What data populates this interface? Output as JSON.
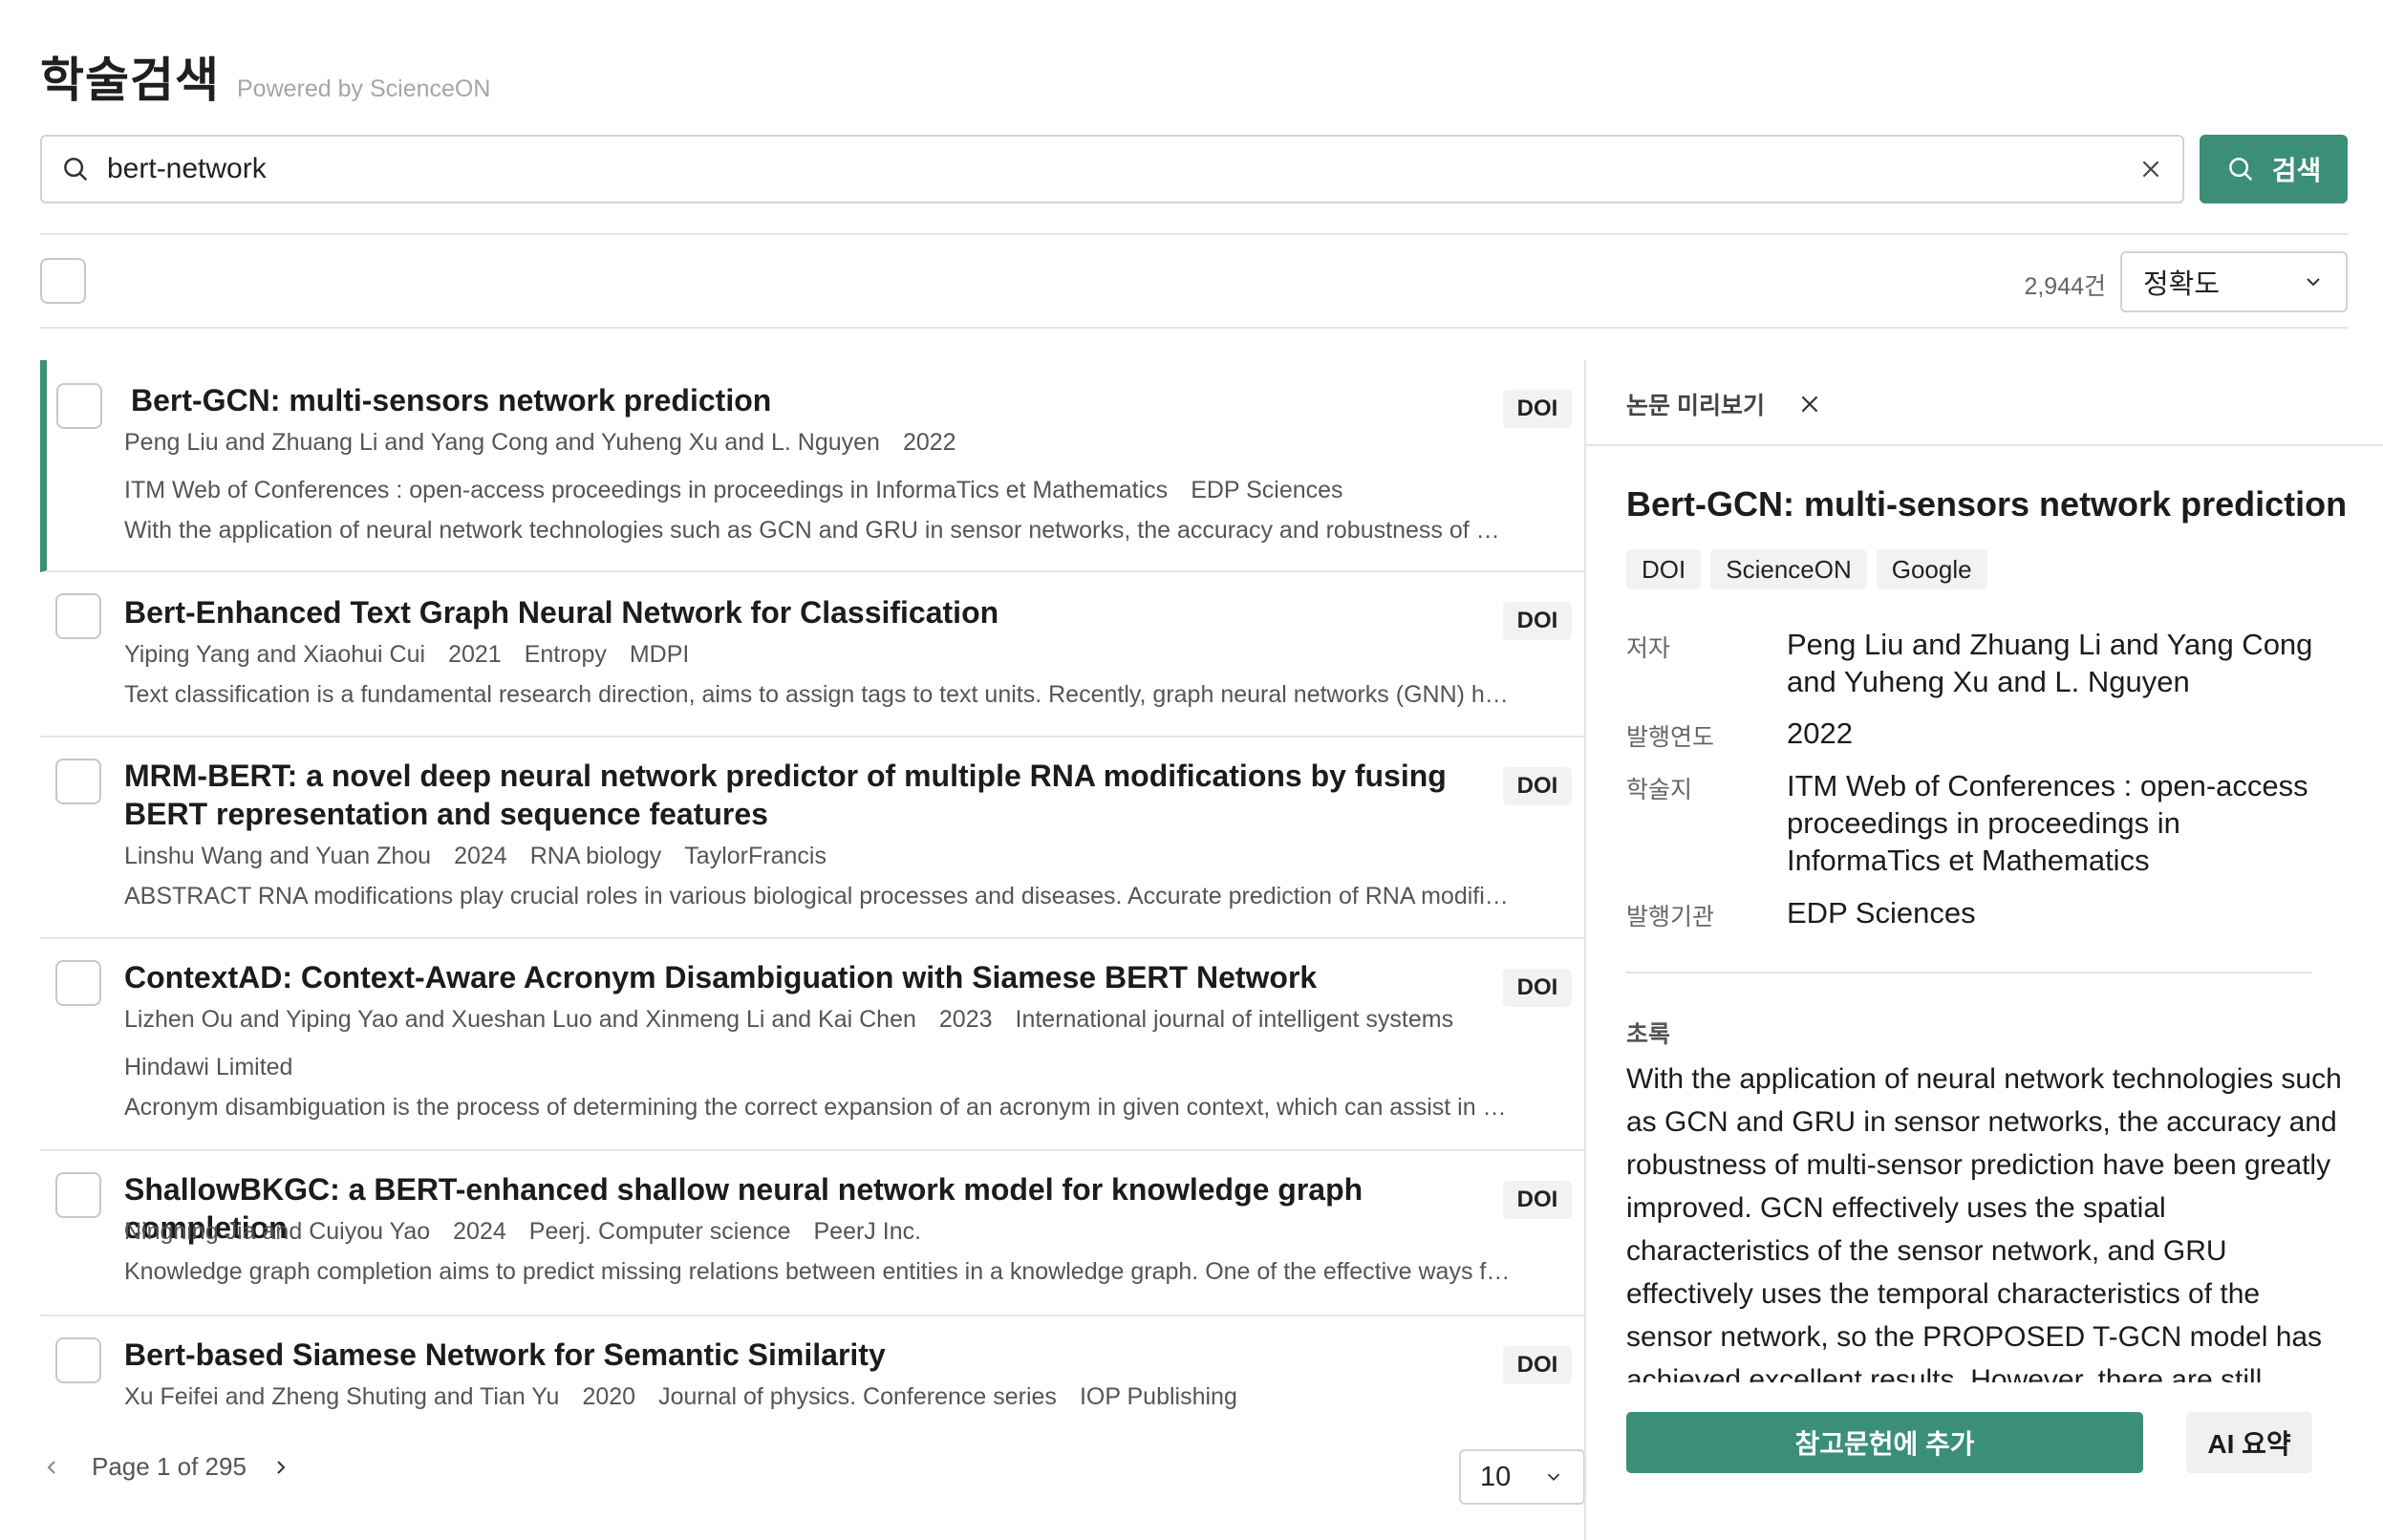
{
  "header": {
    "title": "학술검색",
    "powered_by": "Powered by ScienceON"
  },
  "search": {
    "query": "bert-network",
    "button_label": "검색"
  },
  "toolbar": {
    "result_count": "2,944건",
    "sort": "정확도"
  },
  "results": [
    {
      "title": "Bert-GCN: multi-sensors network prediction",
      "meta_line1": [
        "Peng Liu and Zhuang Li and Yang Cong and Yuheng Xu and L. Nguyen",
        "2022"
      ],
      "meta_line2": [
        "ITM Web of Conferences : open-access proceedings in proceedings in InformaTics et Mathematics",
        "EDP Sciences"
      ],
      "abstract": "With the application of neural network technologies such as GCN and GRU in sensor networks, the accuracy and robustness of multi-sensor prediction have been greatly improved.",
      "badge": "DOI",
      "selected": true
    },
    {
      "title": "Bert-Enhanced Text Graph Neural Network for Classification",
      "meta_line1": [
        "Yiping Yang and Xiaohui Cui",
        "2021",
        "Entropy",
        "MDPI"
      ],
      "abstract": "Text classification is a fundamental research direction, aims to assign tags to text units. Recently, graph neural networks (GNN) have exhibited some excellent properties.",
      "badge": "DOI"
    },
    {
      "title": "MRM-BERT: a novel deep neural network predictor of multiple RNA modifications by fusing BERT representation and sequence features",
      "meta_line1": [
        "Linshu Wang and Yuan Zhou",
        "2024",
        "RNA biology",
        "TaylorFrancis"
      ],
      "abstract": "ABSTRACT RNA modifications play crucial roles in various biological processes and diseases. Accurate prediction of RNA modification sites is essential.",
      "badge": "DOI"
    },
    {
      "title": "ContextAD: Context-Aware Acronym Disambiguation with Siamese BERT Network",
      "meta_line1": [
        "Lizhen Ou and Yiping Yao and Xueshan Luo and Xinmeng Li and Kai Chen",
        "2023",
        "International journal of intelligent systems"
      ],
      "meta_line2": [
        "Hindawi Limited"
      ],
      "abstract": "Acronym disambiguation is the process of determining the correct expansion of an acronym in given context, which can assist in understanding text.",
      "badge": "DOI"
    },
    {
      "title": "ShallowBKGC: a BERT-enhanced shallow neural network model for knowledge graph completion",
      "meta_line1": [
        "Ningning Jia and Cuiyou Yao",
        "2024",
        "Peerj. Computer science",
        "PeerJ Inc."
      ],
      "abstract": "Knowledge graph completion aims to predict missing relations between entities in a knowledge graph. One of the effective ways for knowledge graph completion is",
      "badge": "DOI"
    },
    {
      "title": "Bert-based Siamese Network for Semantic Similarity",
      "meta_line1": [
        "Xu Feifei and Zheng Shuting and Tian Yu",
        "2020",
        "Journal of physics. Conference series",
        "IOP Publishing"
      ],
      "badge": "DOI"
    }
  ],
  "pagination": {
    "label": "Page 1 of 295",
    "page_size": "10"
  },
  "preview": {
    "heading": "논문 미리보기",
    "title": "Bert-GCN: multi-sensors network prediction",
    "links": [
      "DOI",
      "ScienceON",
      "Google"
    ],
    "fields": [
      {
        "label": "저자",
        "value": "Peng Liu and Zhuang Li and Yang Cong and Yuheng Xu and L. Nguyen"
      },
      {
        "label": "발행연도",
        "value": "2022"
      },
      {
        "label": "학술지",
        "value": "ITM Web of Conferences : open-access proceedings in proceedings in InformaTics et Mathematics"
      },
      {
        "label": "발행기관",
        "value": "EDP Sciences"
      }
    ],
    "abstract_label": "초록",
    "abstract": "With the application of neural network technologies such as GCN and GRU in sensor networks, the accuracy and robustness of multi-sensor prediction have been greatly improved. GCN effectively uses the spatial characteristics of the sensor network, and GRU effectively uses the temporal characteristics of the sensor network, so the PROPOSED T-GCN model has achieved excellent results. However, there are still",
    "add_button": "참고문헌에 추가",
    "ai_button": "AI 요약"
  },
  "colors": {
    "accent": "#3b8f78"
  }
}
